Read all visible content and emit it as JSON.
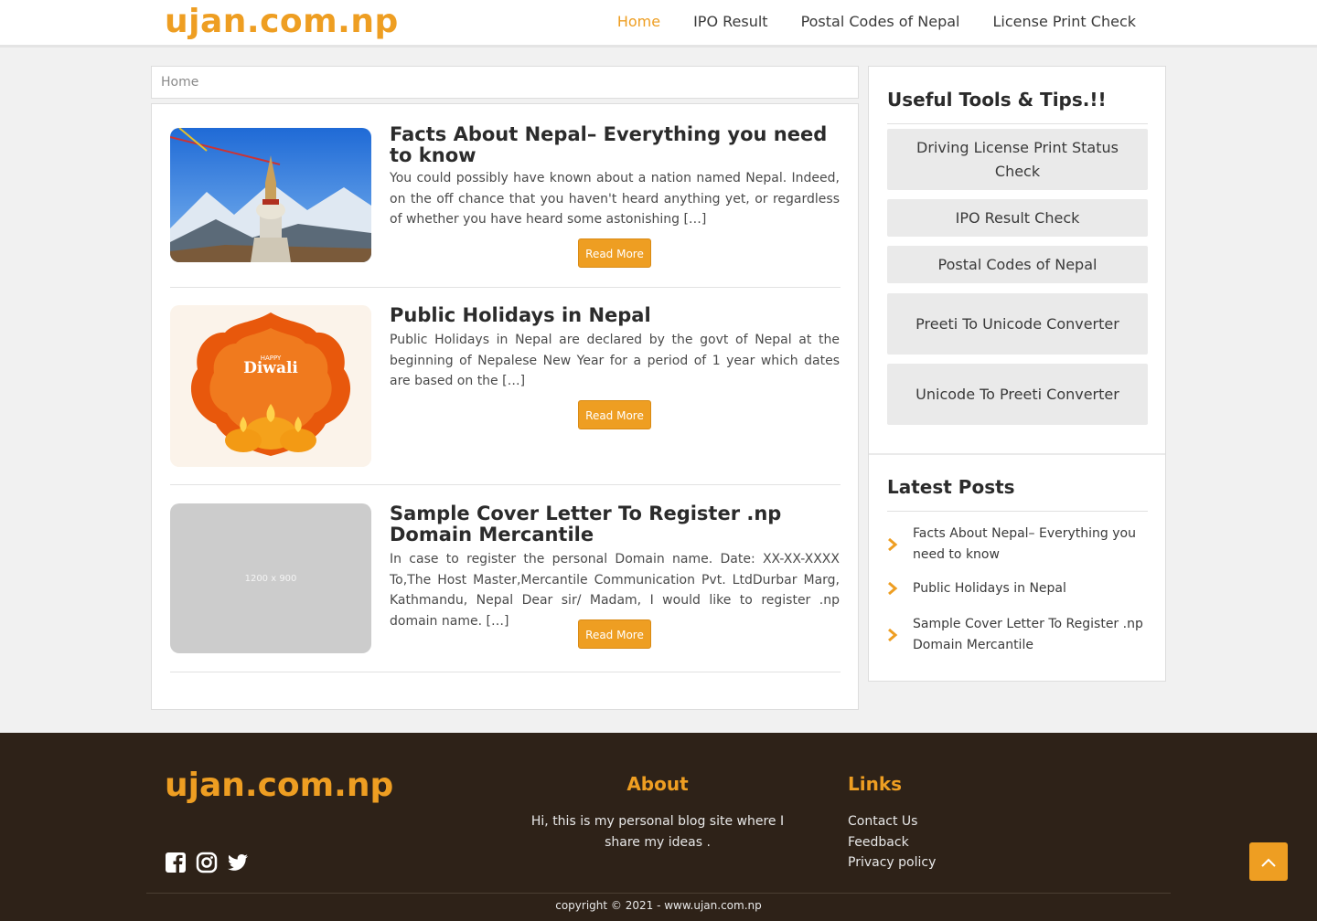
{
  "site": {
    "logo": "ujan.com.np"
  },
  "nav": {
    "items": [
      {
        "label": "Home",
        "active": true
      },
      {
        "label": "IPO Result",
        "active": false
      },
      {
        "label": "Postal Codes of Nepal",
        "active": false
      },
      {
        "label": "License Print Check",
        "active": false
      }
    ]
  },
  "breadcrumb": {
    "label": "Home"
  },
  "posts": [
    {
      "title": "Facts About Nepal– Everything you need to know",
      "excerpt": "You could possibly have known about a nation named Nepal. Indeed, on the off chance that you haven't heard anything yet, or regardless of whether you have heard some astonishing […]",
      "read_more": "Read More"
    },
    {
      "title": "Public Holidays in Nepal",
      "excerpt": "Public Holidays in Nepal are declared by the govt of Nepal at the beginning of Nepalese New Year for a period of 1 year which dates are based on the […]",
      "read_more": "Read More",
      "thumb_text": {
        "top": "HAPPY",
        "main": "Diwali"
      }
    },
    {
      "title": "Sample Cover Letter To Register .np Domain Mercantile",
      "excerpt": "In case to register the personal Domain name. Date: XX-XX-XXXX To,The Host Master,Mercantile Communication Pvt. LtdDurbar Marg, Kathmandu, Nepal Dear sir/ Madam, I would like to register .np domain name. […]",
      "read_more": "Read More",
      "thumb_placeholder": "1200 x 900"
    }
  ],
  "sidebar": {
    "tools_heading": "Useful Tools & Tips.!!",
    "tools": [
      "Driving License Print Status Check",
      "IPO Result Check",
      "Postal Codes of Nepal",
      "Preeti To Unicode Converter",
      "Unicode  To Preeti Converter"
    ],
    "latest_heading": "Latest Posts",
    "latest": [
      "Facts About Nepal– Everything you need to know",
      "Public Holidays in Nepal",
      "Sample Cover Letter To Register .np Domain Mercantile"
    ]
  },
  "footer": {
    "logo": "ujan.com.np",
    "social_icons": [
      "facebook-icon",
      "instagram-icon",
      "twitter-icon"
    ],
    "about_heading": "About",
    "about_text": "Hi, this is my personal blog site where I share my ideas .",
    "links_heading": "Links",
    "links": [
      "Contact Us",
      "Feedback",
      "Privacy policy"
    ],
    "copyright": "copyright © 2021 - www.ujan.com.np"
  },
  "colors": {
    "accent": "#ee9e22",
    "footer_bg": "#2e2218",
    "page_bg": "#f1f1f1"
  }
}
